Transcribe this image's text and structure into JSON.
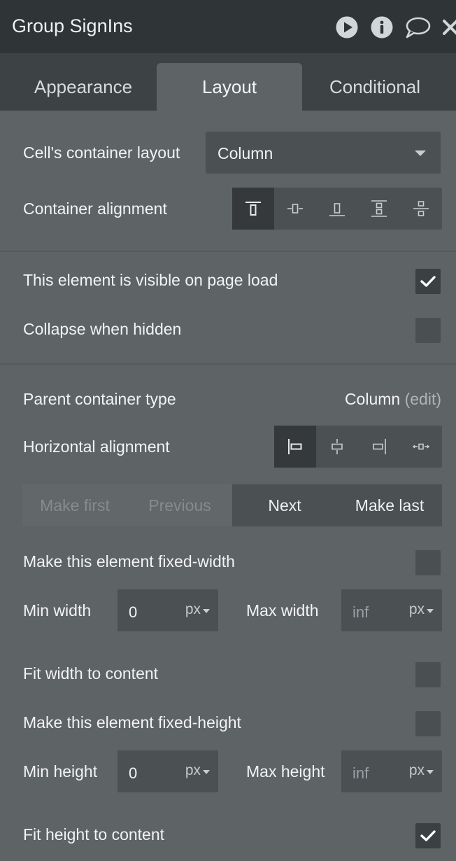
{
  "header": {
    "title": "Group SignIns",
    "icons": [
      "play-icon",
      "info-icon",
      "comment-icon",
      "close-icon"
    ]
  },
  "tabs": [
    {
      "label": "Appearance",
      "active": false
    },
    {
      "label": "Layout",
      "active": true
    },
    {
      "label": "Conditional",
      "active": false
    }
  ],
  "layout": {
    "cells_container_layout_label": "Cell's container layout",
    "cells_container_layout_value": "Column",
    "container_alignment_label": "Container alignment",
    "container_alignment_options": [
      "align-top-icon",
      "align-center-icon",
      "align-bottom-icon",
      "space-between-icon",
      "space-around-icon"
    ],
    "container_alignment_selected": "align-top-icon"
  },
  "visibility": {
    "visible_on_load_label": "This element is visible on page load",
    "visible_on_load_checked": true,
    "collapse_when_hidden_label": "Collapse when hidden",
    "collapse_when_hidden_checked": false
  },
  "parent": {
    "type_label": "Parent container type",
    "type_value": "Column",
    "edit_link": "(edit)",
    "horizontal_alignment_label": "Horizontal alignment",
    "horizontal_alignment_options": [
      "align-left-icon",
      "align-hcenter-icon",
      "align-right-icon",
      "align-hspread-icon"
    ],
    "horizontal_alignment_selected": "align-left-icon"
  },
  "order": {
    "make_first": "Make first",
    "previous": "Previous",
    "next": "Next",
    "make_last": "Make last"
  },
  "width": {
    "fixed_width_label": "Make this element fixed-width",
    "fixed_width_checked": false,
    "min_label": "Min width",
    "min_value": "0",
    "min_unit": "px",
    "max_label": "Max width",
    "max_value": "inf",
    "max_unit": "px",
    "fit_width_label": "Fit width to content",
    "fit_width_checked": false
  },
  "height": {
    "fixed_height_label": "Make this element fixed-height",
    "fixed_height_checked": false,
    "min_label": "Min height",
    "min_value": "0",
    "min_unit": "px",
    "max_label": "Max height",
    "max_value": "inf",
    "max_unit": "px",
    "fit_height_label": "Fit height to content",
    "fit_height_checked": true
  },
  "colors": {
    "header_bg": "#2f3436",
    "tabs_bg": "#3d4245",
    "panel_bg": "#5e6366",
    "control_bg": "#4b5053",
    "selected_bg": "#35393b"
  }
}
